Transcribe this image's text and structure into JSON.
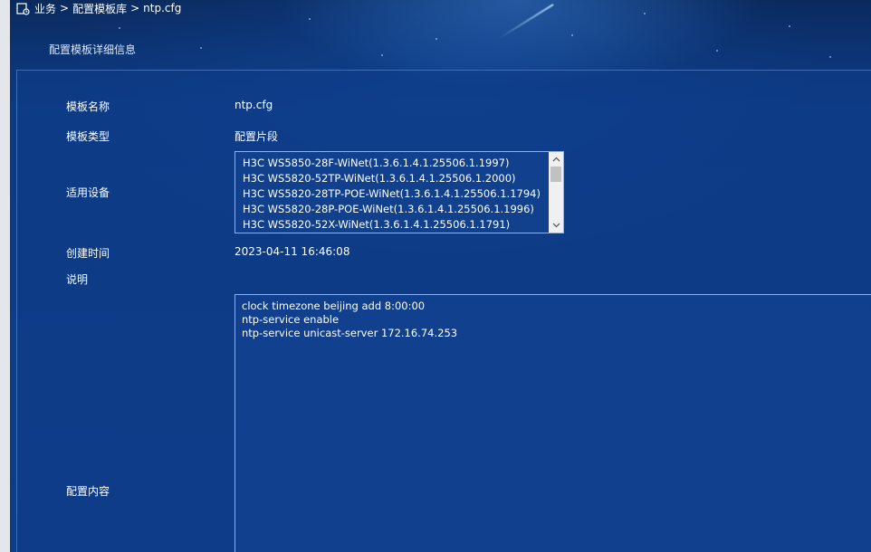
{
  "breadcrumb": {
    "items": [
      "业务",
      "配置模板库",
      "ntp.cfg"
    ],
    "separator": ">"
  },
  "section_title": "配置模板详细信息",
  "fields": {
    "template_name": {
      "label": "模板名称",
      "value": "ntp.cfg"
    },
    "template_type": {
      "label": "模板类型",
      "value": "配置片段"
    },
    "applicable_devices": {
      "label": "适用设备",
      "items": [
        "H3C WS5850-28F-WiNet(1.3.6.1.4.1.25506.1.1997)",
        "H3C WS5820-52TP-WiNet(1.3.6.1.4.1.25506.1.2000)",
        "H3C WS5820-28TP-POE-WiNet(1.3.6.1.4.1.25506.1.1794)",
        "H3C WS5820-28P-POE-WiNet(1.3.6.1.4.1.25506.1.1996)",
        "H3C WS5820-52X-WiNet(1.3.6.1.4.1.25506.1.1791)"
      ]
    },
    "created_time": {
      "label": "创建时间",
      "value": "2023-04-11 16:46:08"
    },
    "description": {
      "label": "说明",
      "value": ""
    },
    "config_content": {
      "label": "配置内容",
      "value": "clock timezone beijing add 8:00:00\nntp-service enable\nntp-service unicast-server 172.16.74.253"
    }
  },
  "colors": {
    "background": "#0f3d88",
    "panel_border": "#3b6fba",
    "text": "#ffffff"
  },
  "icons": {
    "breadcrumb": "template-folder-icon",
    "scroll_up": "chevron-up-icon",
    "scroll_down": "chevron-down-icon"
  }
}
